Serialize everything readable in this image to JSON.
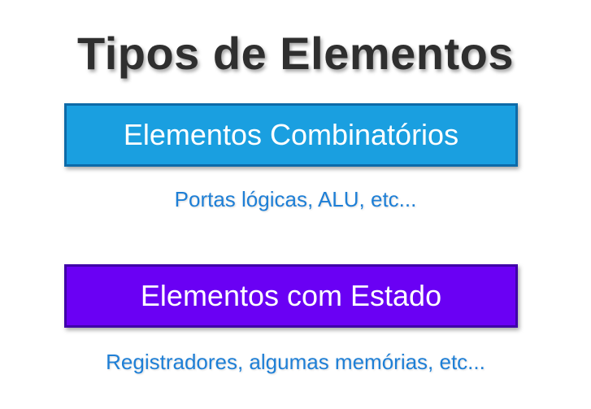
{
  "title": "Tipos de Elementos",
  "sections": [
    {
      "label": "Elementos Combinatórios",
      "caption": "Portas lógicas, ALU, etc...",
      "fill": "#1a9fe0",
      "border": "#0d6aa8"
    },
    {
      "label": "Elementos com Estado",
      "caption": "Registradores, algumas memórias, etc...",
      "fill": "#6a00f4",
      "border": "#3f00a8"
    }
  ],
  "colors": {
    "title": "#2f2f2f",
    "caption": "#1e7fd6",
    "box_text": "#ffffff"
  }
}
